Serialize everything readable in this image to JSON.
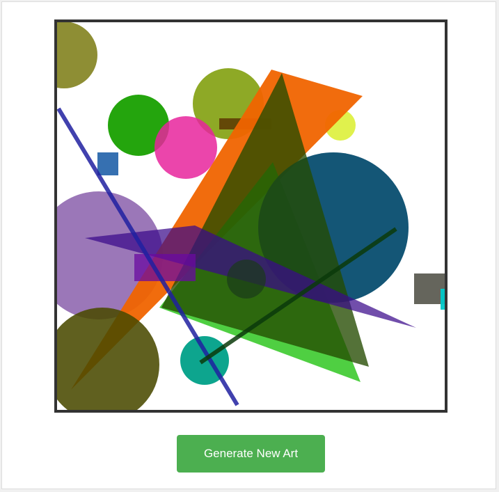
{
  "actions": {
    "generate_label": "Generate New Art"
  },
  "colors": {
    "button_bg": "#4caf50",
    "frame_border": "#333333",
    "page_bg": "#f0f0f0"
  },
  "artwork": {
    "shapes": [
      {
        "kind": "circle",
        "name": "olive-circle-top-left",
        "color": "#7a7a10",
        "opacity": 0.85
      },
      {
        "kind": "circle",
        "name": "green-circle",
        "color": "#18a000",
        "opacity": 0.95
      },
      {
        "kind": "circle",
        "name": "olive-circle-top",
        "color": "#7a9a00",
        "opacity": 0.85
      },
      {
        "kind": "circle",
        "name": "pink-circle",
        "color": "#e8249c",
        "opacity": 0.85
      },
      {
        "kind": "circle",
        "name": "yellow-circle-small",
        "color": "#d8ee20",
        "opacity": 0.8
      },
      {
        "kind": "rect",
        "name": "blue-square-small",
        "color": "#2060a8",
        "opacity": 0.9
      },
      {
        "kind": "rect",
        "name": "dark-brown-bar",
        "color": "#5a3000",
        "opacity": 0.8
      },
      {
        "kind": "circle",
        "name": "purple-circle-large",
        "color": "#7a4aa0",
        "opacity": 0.75
      },
      {
        "kind": "polygon",
        "name": "orange-triangle",
        "color": "#f06400",
        "opacity": 0.95
      },
      {
        "kind": "polygon",
        "name": "green-triangle",
        "color": "#28c418",
        "opacity": 0.82
      },
      {
        "kind": "circle",
        "name": "dark-teal-circle-large",
        "color": "#00486a",
        "opacity": 0.92
      },
      {
        "kind": "polygon",
        "name": "dark-olive-triangle",
        "color": "#244a00",
        "opacity": 0.78
      },
      {
        "kind": "polygon",
        "name": "indigo-triangle",
        "color": "#3a0a8a",
        "opacity": 0.72
      },
      {
        "kind": "rect",
        "name": "purple-rect",
        "color": "#6a0aa0",
        "opacity": 0.75
      },
      {
        "kind": "circle",
        "name": "dark-circle-small-center",
        "color": "#1a3a1a",
        "opacity": 0.7
      },
      {
        "kind": "circle",
        "name": "olive-circle-bottom-left",
        "color": "#4a4a00",
        "opacity": 0.88
      },
      {
        "kind": "circle",
        "name": "teal-circle",
        "color": "#00a088",
        "opacity": 0.95
      },
      {
        "kind": "line",
        "name": "blue-diagonal-line",
        "color": "#2020a0",
        "opacity": 0.85
      },
      {
        "kind": "line",
        "name": "dark-green-line",
        "color": "#0a3a0a",
        "opacity": 0.85
      },
      {
        "kind": "rect",
        "name": "gray-square",
        "color": "#4a4a40",
        "opacity": 0.85
      },
      {
        "kind": "rect",
        "name": "cyan-sliver",
        "color": "#00c8c8",
        "opacity": 0.95
      }
    ]
  }
}
